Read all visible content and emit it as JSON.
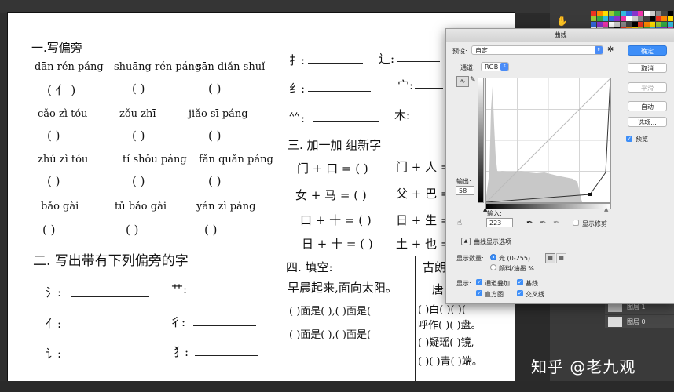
{
  "worksheet": {
    "s1_title": "一.写偏旁",
    "r1": [
      "dān rén páng",
      "shuāng rén páng",
      "sān diǎn shuǐ"
    ],
    "r1a": [
      "( 亻 )",
      "(      )",
      "(      )"
    ],
    "r2": [
      "cǎo zì tóu",
      "zǒu zhī",
      "jiǎo sī páng"
    ],
    "r2a": [
      "(      )",
      "(      )",
      "(      )"
    ],
    "r3": [
      "zhú zì tóu",
      "tí shǒu páng",
      "fǎn quǎn páng"
    ],
    "r3a": [
      "(      )",
      "(      )",
      "(      )"
    ],
    "r4": [
      "bǎo gài",
      "tǔ bǎo gài",
      "yán zì páng"
    ],
    "r4a": [
      "(      )",
      "(      )",
      "(      )"
    ],
    "s2_title": "二. 写出带有下列偏旁的字",
    "s2_rows": [
      {
        "a": "氵:",
        "b": "艹:"
      },
      {
        "a": "亻:",
        "b": "彳:"
      },
      {
        "a": "讠:",
        "b": "犭:"
      }
    ],
    "right_top": [
      {
        "a": "扌:",
        "b": "辶:"
      },
      {
        "a": "纟:",
        "b": "宀:"
      },
      {
        "a": "⺮:",
        "b": "木:"
      }
    ],
    "s3_title": "三. 加一加  组新字",
    "s3_rows": [
      {
        "a": "门 + 口 = (      )",
        "b": "门 + 人 ="
      },
      {
        "a": "女 + 马 = (      )",
        "b": "父 + 巴 ="
      },
      {
        "a": "口 + 十 = (      )",
        "b": "日 + 生 ="
      },
      {
        "a": "日 + 十 = (      )",
        "b": "土 + 也 ="
      }
    ],
    "s4_title": "四. 填空:",
    "s4_line": "早晨起来,面向太阳。",
    "s4_rows": [
      "(    )面是(    ),(    )面是(",
      "(    )面是(    ),(    )面是("
    ],
    "s5_title": "古朗",
    "s5_rows": [
      "唐",
      "(   )白(   )(   )(",
      "呼作(   )(   )盘。",
      "(   )疑瑶(   )镜,",
      "(   )(   )青(   )端。"
    ]
  },
  "dialog": {
    "title": "曲线",
    "preset_label": "预设:",
    "preset_value": "自定",
    "channel_label": "通道:",
    "channel_value": "RGB",
    "btn_ok": "确定",
    "btn_cancel": "取消",
    "btn_smooth": "平滑",
    "btn_auto": "自动",
    "btn_options": "选项...",
    "preview_label": "预览",
    "output_label": "输出:",
    "output_value": "58",
    "input_label": "输入:",
    "input_value": "223",
    "show_clipping": "显示修剪",
    "display_options": "曲线显示选项",
    "show_amount_label": "显示数量:",
    "opt_light": "光 (0-255)",
    "opt_pigment": "颜料/油墨 %",
    "show_label": "显示:",
    "chk_channel_overlay": "通道叠加",
    "chk_baseline": "基线",
    "chk_histogram": "直方图",
    "chk_intersection": "交叉线"
  },
  "layers": [
    "图层 1",
    "图层 0"
  ],
  "watermark": "知乎 @老九观"
}
